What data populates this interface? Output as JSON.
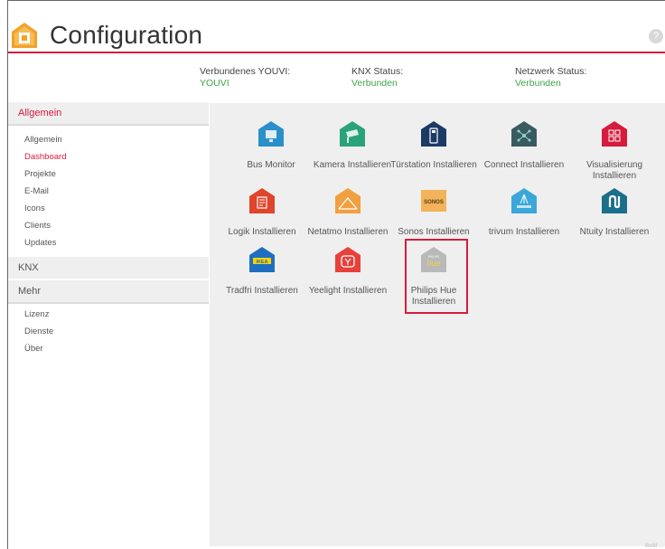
{
  "header": {
    "title": "Configuration",
    "help_label": "?"
  },
  "status": [
    {
      "label": "Verbundenes YOUVI:",
      "value": "YOUVI"
    },
    {
      "label": "KNX Status:",
      "value": "Verbunden"
    },
    {
      "label": "Netzwerk Status:",
      "value": "Verbunden"
    }
  ],
  "sidebar": {
    "allgemein_header": "Allgemein",
    "allgemein_items": [
      "Allgemein",
      "Dashboard",
      "Projekte",
      "E-Mail",
      "Icons",
      "Clients",
      "Updates"
    ],
    "active_item": "Dashboard",
    "knx_header": "KNX",
    "mehr_header": "Mehr",
    "mehr_items": [
      "Lizenz",
      "Dienste",
      "Über"
    ]
  },
  "tiles": [
    {
      "label": "Bus Monitor",
      "icon": "bus-monitor-icon",
      "color": "#2b8fc9"
    },
    {
      "label": "Kamera Installieren",
      "icon": "camera-icon",
      "color": "#2aa37a"
    },
    {
      "label": "Türstation Installieren",
      "icon": "door-station-icon",
      "color": "#1c3a66"
    },
    {
      "label": "Connect Installieren",
      "icon": "connect-icon",
      "color": "#3b5a5f"
    },
    {
      "label": "Visualisierung Installieren",
      "icon": "visualization-icon",
      "color": "#d61b3c"
    },
    {
      "label": "Logik Installieren",
      "icon": "logic-icon",
      "color": "#e0442a"
    },
    {
      "label": "Netatmo Installieren",
      "icon": "netatmo-icon",
      "color": "#f0a040"
    },
    {
      "label": "Sonos Installieren",
      "icon": "sonos-icon",
      "color": "#f2b35a"
    },
    {
      "label": "trivum Installieren",
      "icon": "trivum-icon",
      "color": "#3ba7d9"
    },
    {
      "label": "Ntuity Installieren",
      "icon": "ntuity-icon",
      "color": "#1a6f8a"
    },
    {
      "label": "Tradfri Installieren",
      "icon": "ikea-tradfri-icon",
      "color": "#1e6fc2"
    },
    {
      "label": "Yeelight Installieren",
      "icon": "yeelight-icon",
      "color": "#e8403a"
    },
    {
      "label": "Philips Hue Installieren",
      "icon": "philips-hue-icon",
      "color": "#b9b9b9"
    }
  ],
  "icon_texts": {
    "sonos": "SONOS",
    "ikea": "IKEA",
    "hue_brand": "PHILIPS",
    "hue": "hue"
  },
  "colors": {
    "accent": "#d61b3c",
    "status_ok": "#3fa64a"
  },
  "footer": "Build ..."
}
